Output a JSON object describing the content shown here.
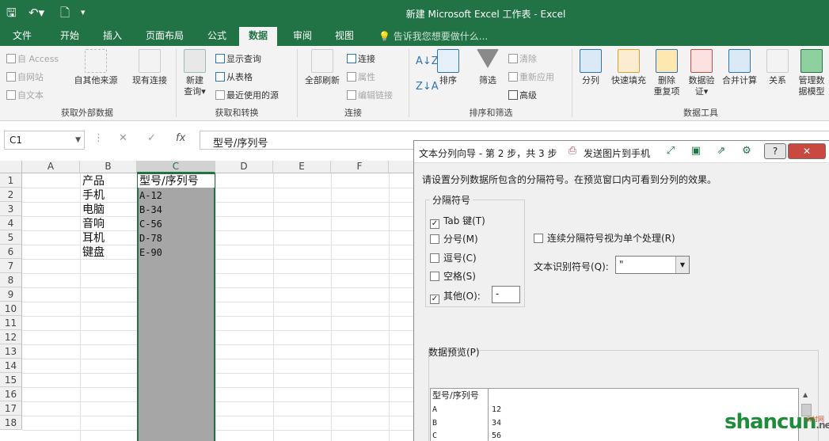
{
  "colors": {
    "accent": "#217346",
    "selection": "#a6a6a6",
    "close": "#c9483f"
  },
  "app": {
    "title": "新建 Microsoft Excel 工作表 - Excel"
  },
  "qat": {
    "save_icon": "save-icon",
    "undo_icon": "undo-icon",
    "new_icon": "new-file-icon"
  },
  "tabs": [
    {
      "label": "文件"
    },
    {
      "label": "开始"
    },
    {
      "label": "插入"
    },
    {
      "label": "页面布局"
    },
    {
      "label": "公式"
    },
    {
      "label": "数据"
    },
    {
      "label": "审阅"
    },
    {
      "label": "视图"
    }
  ],
  "tellme": "告诉我您想要做什么...",
  "ribbon": {
    "ext": {
      "access": "自 Access",
      "web": "自网站",
      "text": "自文本",
      "other": "自其他来源",
      "existing": "现有连接",
      "group": "获取外部数据"
    },
    "transform": {
      "new_query_1": "新建",
      "new_query_2": "查询",
      "show_query": "显示查询",
      "from_table": "从表格",
      "recent": "最近使用的源",
      "group": "获取和转换"
    },
    "conn": {
      "refresh_all": "全部刷新",
      "connections": "连接",
      "properties": "属性",
      "edit_links": "编辑链接",
      "group": "连接"
    },
    "sort": {
      "sort": "排序",
      "filter": "筛选",
      "clear": "清除",
      "reapply": "重新应用",
      "advanced": "高级",
      "group": "排序和筛选"
    },
    "tools": {
      "split": "分列",
      "flash": "快速填充",
      "dup_1": "删除",
      "dup_2": "重复项",
      "valid_1": "数据验",
      "valid_2": "证",
      "consolidate": "合并计算",
      "relations": "关系",
      "model_1": "管理数",
      "model_2": "据模型",
      "group": "数据工具"
    }
  },
  "namebox": {
    "value": "C1"
  },
  "formula": {
    "fx": "fx",
    "value": "型号/序列号"
  },
  "sheet": {
    "columns": [
      "A",
      "B",
      "C",
      "D",
      "E",
      "F"
    ],
    "rows": [
      "1",
      "2",
      "3",
      "4",
      "5",
      "6",
      "7",
      "8",
      "9",
      "10",
      "11",
      "12",
      "13",
      "14",
      "15",
      "16",
      "17",
      "18"
    ],
    "colB": [
      "产品",
      "手机",
      "电脑",
      "音响",
      "耳机",
      "键盘"
    ],
    "colC": [
      "型号/序列号",
      "A-12",
      "B-34",
      "C-56",
      "D-78",
      "E-90"
    ]
  },
  "wizard": {
    "title": "文本分列向导 - 第 2 步，共 3 步",
    "send": "发送图片到手机",
    "help": "?",
    "close": "✕",
    "desc": "请设置分列数据所包含的分隔符号。在预览窗口内可看到分列的效果。",
    "delim_title": "分隔符号",
    "options": [
      {
        "label": "Tab 键(T)",
        "checked": "✓"
      },
      {
        "label": "分号(M)",
        "checked": ""
      },
      {
        "label": "逗号(C)",
        "checked": ""
      },
      {
        "label": "空格(S)",
        "checked": ""
      },
      {
        "label": "其他(O):",
        "checked": "✓"
      }
    ],
    "other_value": "-",
    "consecutive": "连续分隔符号视为单个处理(R)",
    "qualifier_label": "文本识别符号(Q):",
    "qualifier_value": "\"",
    "preview_label": "数据预览(P)",
    "preview_header": "型号/序列号",
    "preview_left": [
      "A",
      "B",
      "C"
    ],
    "preview_right": [
      "12",
      "34",
      "56"
    ]
  },
  "watermark": {
    "main": "shancun",
    "net": ".net",
    "sub": "山村网"
  }
}
